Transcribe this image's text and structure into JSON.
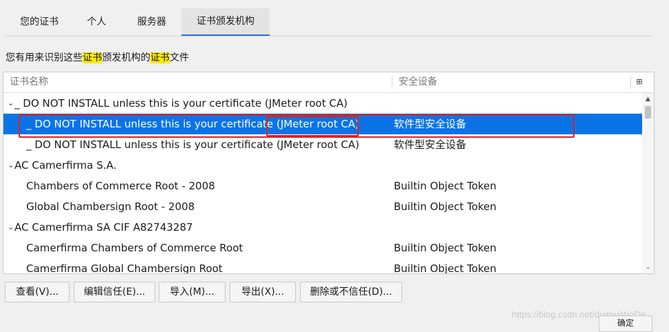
{
  "tabs": [
    {
      "label": "您的证书"
    },
    {
      "label": "个人"
    },
    {
      "label": "服务器"
    },
    {
      "label": "证书颁发机构"
    }
  ],
  "description": {
    "before": "您有用来识别这些",
    "hl1": "证书",
    "middle": "颁发机构的",
    "hl2": "证书",
    "after": "文件"
  },
  "columns": {
    "name": "证书名称",
    "device": "安全设备",
    "picker_icon": "column-picker-icon"
  },
  "rows": [
    {
      "name": "_ DO NOT INSTALL unless this is your certificate (JMeter root CA)",
      "device": ""
    },
    {
      "name": "_ DO NOT INSTALL unless this is your certificate (JMeter root CA)",
      "device": "软件型安全设备"
    },
    {
      "name": "_ DO NOT INSTALL unless this is your certificate (JMeter root CA)",
      "device": "软件型安全设备"
    },
    {
      "name": "AC Camerfirma S.A.",
      "device": ""
    },
    {
      "name": "Chambers of Commerce Root - 2008",
      "device": "Builtin Object Token"
    },
    {
      "name": "Global Chambersign Root - 2008",
      "device": "Builtin Object Token"
    },
    {
      "name": "AC Camerfirma SA CIF A82743287",
      "device": ""
    },
    {
      "name": "Camerfirma Chambers of Commerce Root",
      "device": "Builtin Object Token"
    },
    {
      "name": "Camerfirma Global Chambersign Root",
      "device": "Builtin Object Token"
    }
  ],
  "buttons": {
    "view": "查看(V)...",
    "edit_trust": "编辑信任(E)...",
    "import": "导入(M)...",
    "export": "导出(X)...",
    "delete": "删除或不信任(D)...",
    "ok": "确定"
  },
  "watermark": "https://blog.csdn.net/duzhuiWoDe",
  "colors": {
    "selection": "#0a74e6",
    "highlight": "#ffea00",
    "annotation": "#e02020",
    "active_tab_underline": "#2d72d9"
  }
}
